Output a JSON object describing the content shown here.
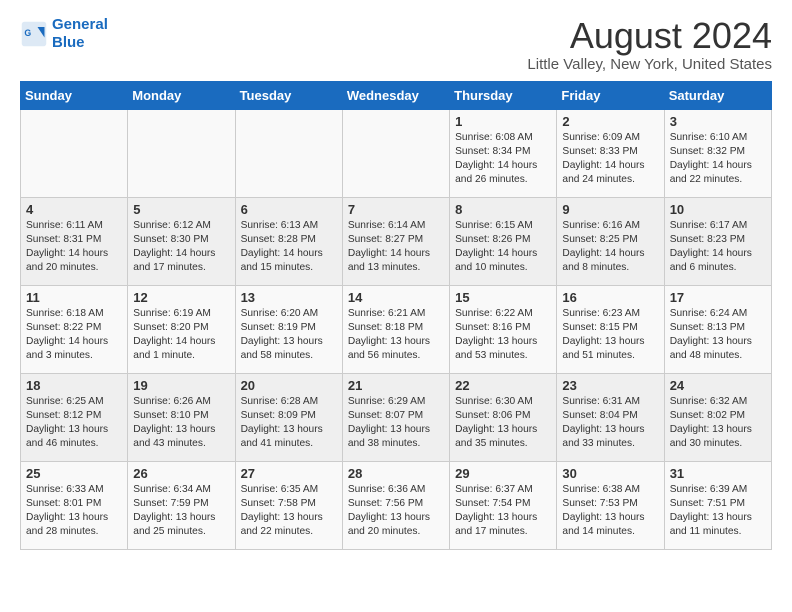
{
  "logo": {
    "line1": "General",
    "line2": "Blue"
  },
  "title": "August 2024",
  "location": "Little Valley, New York, United States",
  "weekdays": [
    "Sunday",
    "Monday",
    "Tuesday",
    "Wednesday",
    "Thursday",
    "Friday",
    "Saturday"
  ],
  "weeks": [
    [
      {
        "day": "",
        "info": ""
      },
      {
        "day": "",
        "info": ""
      },
      {
        "day": "",
        "info": ""
      },
      {
        "day": "",
        "info": ""
      },
      {
        "day": "1",
        "info": "Sunrise: 6:08 AM\nSunset: 8:34 PM\nDaylight: 14 hours\nand 26 minutes."
      },
      {
        "day": "2",
        "info": "Sunrise: 6:09 AM\nSunset: 8:33 PM\nDaylight: 14 hours\nand 24 minutes."
      },
      {
        "day": "3",
        "info": "Sunrise: 6:10 AM\nSunset: 8:32 PM\nDaylight: 14 hours\nand 22 minutes."
      }
    ],
    [
      {
        "day": "4",
        "info": "Sunrise: 6:11 AM\nSunset: 8:31 PM\nDaylight: 14 hours\nand 20 minutes."
      },
      {
        "day": "5",
        "info": "Sunrise: 6:12 AM\nSunset: 8:30 PM\nDaylight: 14 hours\nand 17 minutes."
      },
      {
        "day": "6",
        "info": "Sunrise: 6:13 AM\nSunset: 8:28 PM\nDaylight: 14 hours\nand 15 minutes."
      },
      {
        "day": "7",
        "info": "Sunrise: 6:14 AM\nSunset: 8:27 PM\nDaylight: 14 hours\nand 13 minutes."
      },
      {
        "day": "8",
        "info": "Sunrise: 6:15 AM\nSunset: 8:26 PM\nDaylight: 14 hours\nand 10 minutes."
      },
      {
        "day": "9",
        "info": "Sunrise: 6:16 AM\nSunset: 8:25 PM\nDaylight: 14 hours\nand 8 minutes."
      },
      {
        "day": "10",
        "info": "Sunrise: 6:17 AM\nSunset: 8:23 PM\nDaylight: 14 hours\nand 6 minutes."
      }
    ],
    [
      {
        "day": "11",
        "info": "Sunrise: 6:18 AM\nSunset: 8:22 PM\nDaylight: 14 hours\nand 3 minutes."
      },
      {
        "day": "12",
        "info": "Sunrise: 6:19 AM\nSunset: 8:20 PM\nDaylight: 14 hours\nand 1 minute."
      },
      {
        "day": "13",
        "info": "Sunrise: 6:20 AM\nSunset: 8:19 PM\nDaylight: 13 hours\nand 58 minutes."
      },
      {
        "day": "14",
        "info": "Sunrise: 6:21 AM\nSunset: 8:18 PM\nDaylight: 13 hours\nand 56 minutes."
      },
      {
        "day": "15",
        "info": "Sunrise: 6:22 AM\nSunset: 8:16 PM\nDaylight: 13 hours\nand 53 minutes."
      },
      {
        "day": "16",
        "info": "Sunrise: 6:23 AM\nSunset: 8:15 PM\nDaylight: 13 hours\nand 51 minutes."
      },
      {
        "day": "17",
        "info": "Sunrise: 6:24 AM\nSunset: 8:13 PM\nDaylight: 13 hours\nand 48 minutes."
      }
    ],
    [
      {
        "day": "18",
        "info": "Sunrise: 6:25 AM\nSunset: 8:12 PM\nDaylight: 13 hours\nand 46 minutes."
      },
      {
        "day": "19",
        "info": "Sunrise: 6:26 AM\nSunset: 8:10 PM\nDaylight: 13 hours\nand 43 minutes."
      },
      {
        "day": "20",
        "info": "Sunrise: 6:28 AM\nSunset: 8:09 PM\nDaylight: 13 hours\nand 41 minutes."
      },
      {
        "day": "21",
        "info": "Sunrise: 6:29 AM\nSunset: 8:07 PM\nDaylight: 13 hours\nand 38 minutes."
      },
      {
        "day": "22",
        "info": "Sunrise: 6:30 AM\nSunset: 8:06 PM\nDaylight: 13 hours\nand 35 minutes."
      },
      {
        "day": "23",
        "info": "Sunrise: 6:31 AM\nSunset: 8:04 PM\nDaylight: 13 hours\nand 33 minutes."
      },
      {
        "day": "24",
        "info": "Sunrise: 6:32 AM\nSunset: 8:02 PM\nDaylight: 13 hours\nand 30 minutes."
      }
    ],
    [
      {
        "day": "25",
        "info": "Sunrise: 6:33 AM\nSunset: 8:01 PM\nDaylight: 13 hours\nand 28 minutes."
      },
      {
        "day": "26",
        "info": "Sunrise: 6:34 AM\nSunset: 7:59 PM\nDaylight: 13 hours\nand 25 minutes."
      },
      {
        "day": "27",
        "info": "Sunrise: 6:35 AM\nSunset: 7:58 PM\nDaylight: 13 hours\nand 22 minutes."
      },
      {
        "day": "28",
        "info": "Sunrise: 6:36 AM\nSunset: 7:56 PM\nDaylight: 13 hours\nand 20 minutes."
      },
      {
        "day": "29",
        "info": "Sunrise: 6:37 AM\nSunset: 7:54 PM\nDaylight: 13 hours\nand 17 minutes."
      },
      {
        "day": "30",
        "info": "Sunrise: 6:38 AM\nSunset: 7:53 PM\nDaylight: 13 hours\nand 14 minutes."
      },
      {
        "day": "31",
        "info": "Sunrise: 6:39 AM\nSunset: 7:51 PM\nDaylight: 13 hours\nand 11 minutes."
      }
    ]
  ]
}
